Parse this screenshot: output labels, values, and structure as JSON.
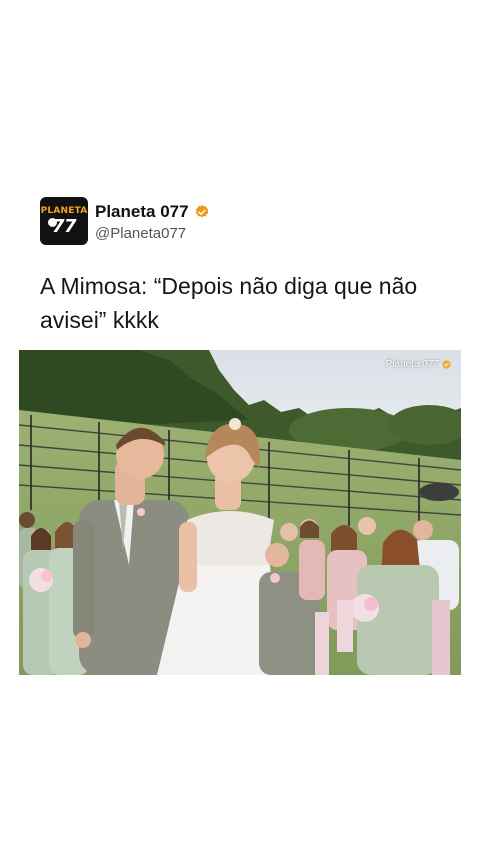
{
  "post": {
    "author": {
      "display_name": "Planeta 077",
      "handle": "@Planeta077",
      "verified": true,
      "verified_icon": "verified-badge-icon",
      "verified_color": "#e89b1a",
      "avatar": {
        "line1": "PLANETA",
        "line2": "77",
        "background": "#111111",
        "accent": "#f7a21b"
      }
    },
    "text": "A Mimosa: “Depois não diga que não avisei” kkkk",
    "media": {
      "watermark": "Planeta 077",
      "description_icon": "video-frame"
    }
  }
}
